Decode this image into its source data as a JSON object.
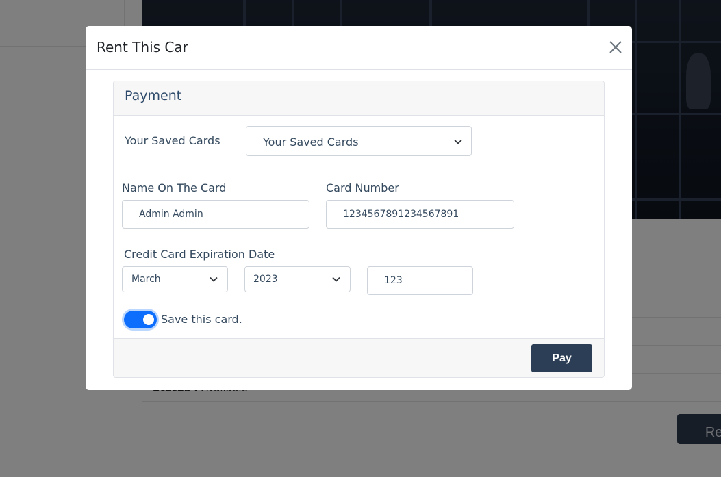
{
  "background": {
    "status_label": "Status :",
    "status_value": "Available",
    "rent_button_label": "Rent"
  },
  "modal": {
    "title": "Rent This Car",
    "payment": {
      "heading": "Payment",
      "saved_cards_label": "Your Saved Cards",
      "saved_cards_selected": "Your Saved Cards",
      "name_label": "Name On The Card",
      "name_value": "Admin Admin",
      "number_label": "Card Number",
      "number_value": "1234567891234567891",
      "expiration_label": "Credit Card Expiration Date",
      "month_selected": "March",
      "year_selected": "2023",
      "cvv_value": "123",
      "save_card_label": "Save this card.",
      "save_card_checked": true,
      "pay_button_label": "Pay"
    }
  },
  "colors": {
    "accent_toggle": "#0d6efd",
    "pay_button": "#2c3e55",
    "backdrop": "rgba(0,0,0,0.5)"
  },
  "icons": {
    "close": "close-icon",
    "dropdown": "chevron-down-icon"
  }
}
